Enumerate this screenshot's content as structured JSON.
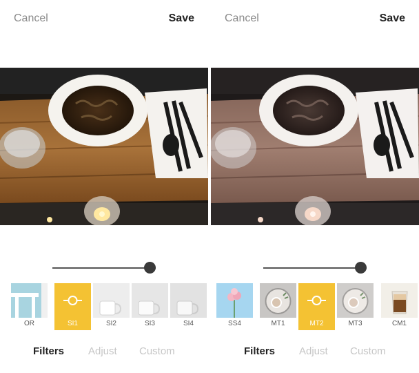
{
  "left_panel": {
    "cancel_label": "Cancel",
    "save_label": "Save",
    "slider_value": 1.0,
    "filters": [
      {
        "label": "OR",
        "active": false
      },
      {
        "label": "SI1",
        "active": true
      },
      {
        "label": "SI2",
        "active": false
      },
      {
        "label": "SI3",
        "active": false
      },
      {
        "label": "SI4",
        "active": false
      }
    ],
    "tabs": [
      {
        "label": "Filters",
        "active": true
      },
      {
        "label": "Adjust",
        "active": false
      },
      {
        "label": "Custom",
        "active": false
      }
    ]
  },
  "right_panel": {
    "cancel_label": "Cancel",
    "save_label": "Save",
    "slider_value": 1.0,
    "filters": [
      {
        "label": "SS4",
        "active": false
      },
      {
        "label": "MT1",
        "active": false
      },
      {
        "label": "MT2",
        "active": true
      },
      {
        "label": "MT3",
        "active": false
      },
      {
        "label": "CM1",
        "active": false
      }
    ],
    "tabs": [
      {
        "label": "Filters",
        "active": true
      },
      {
        "label": "Adjust",
        "active": false
      },
      {
        "label": "Custom",
        "active": false
      }
    ]
  },
  "colors": {
    "accent": "#f4c233",
    "text_dark": "#222222",
    "text_muted": "#8a8a8a",
    "tab_inactive": "#c6c6c6"
  }
}
